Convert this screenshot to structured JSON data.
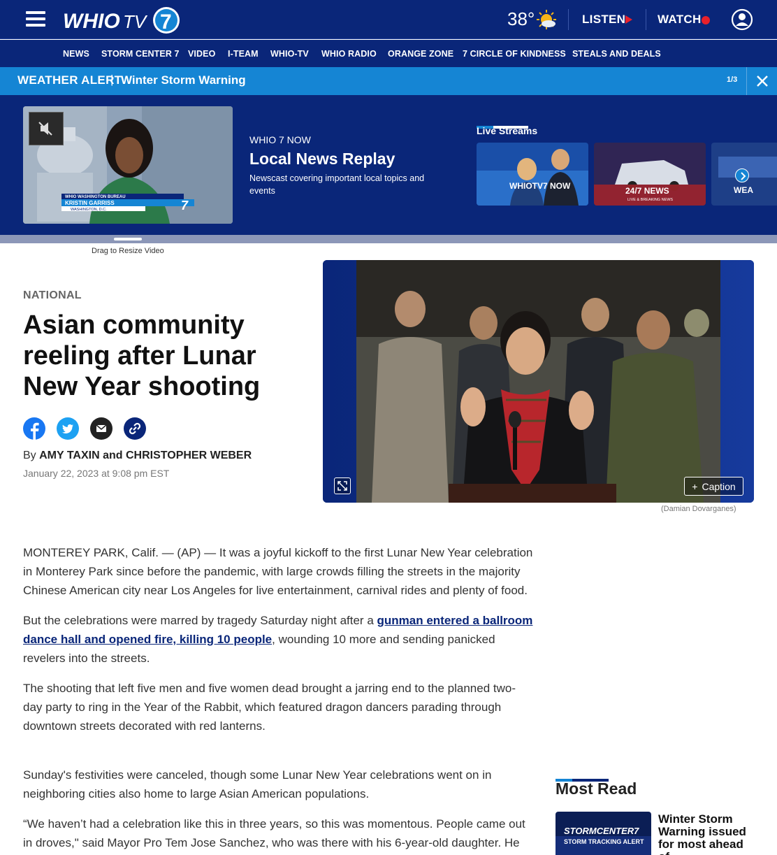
{
  "header": {
    "logo_text": "WHIOTV7",
    "temperature": "38°",
    "weather_icon": "partly-sunny-icon",
    "listen_label": "LISTEN",
    "watch_label": "WATCH"
  },
  "nav": {
    "items": [
      "NEWS",
      "STORM CENTER 7",
      "VIDEO",
      "I-TEAM",
      "WHIO-TV",
      "WHIO RADIO",
      "ORANGE ZONE",
      "7 CIRCLE OF KINDNESS",
      "STEALS AND DEALS"
    ]
  },
  "alert": {
    "label": "WEATHER ALERT",
    "separator": "|",
    "text": "Winter Storm Warning",
    "count": "1/3"
  },
  "video_panel": {
    "thumb_lower_third_bureau": "WHIO WASHINGTON BUREAU",
    "thumb_lower_third_name": "KRISTIN GARRISS",
    "thumb_lower_third_place": "WASHINGTON, D.C.",
    "kicker": "WHIO 7 NOW",
    "title": "Local News Replay",
    "description": "Newscast covering important local topics and events",
    "live_streams_title": "Live Streams",
    "stream_1_label": "WHIOTV7 NOW",
    "stream_2_label": "24/7 NEWS",
    "stream_2_sublabel": "LIVE & BREAKING NEWS",
    "stream_3_label": "WEA",
    "resize_label": "Drag to Resize Video"
  },
  "article": {
    "section": "NATIONAL",
    "headline": "Asian community reeling after Lunar New Year shooting",
    "byline_prefix": "By",
    "authors": "AMY TAXIN and CHRISTOPHER WEBER",
    "date": "January 22, 2023 at 9:08 pm EST",
    "caption_button": "Caption",
    "photo_credit": "(Damian Dovarganes)",
    "p1": "MONTEREY PARK, Calif. — (AP) — It was a joyful kickoff to the first Lunar New Year celebration in Monterey Park since before the pandemic, with large crowds filling the streets in the majority Chinese American city near Los Angeles for live entertainment, carnival rides and plenty of food.",
    "p2_before": "But the celebrations were marred by tragedy Saturday night after a ",
    "p2_link": "gunman entered a ballroom dance hall and opened fire, killing 10 people",
    "p2_after": ", wounding 10 more and sending panicked revelers into the streets.",
    "p3": "The shooting that left five men and five women dead brought a jarring end to the planned two-day party to ring in the Year of the Rabbit, which featured dragon dancers parading through downtown streets decorated with red lanterns.",
    "p4": "Sunday's festivities were canceled, though some Lunar New Year celebrations went on in neighboring cities also home to large Asian American populations.",
    "p5": "“We haven’t had a celebration like this in three years, so this was momentous. People came out in droves,\" said Mayor Pro Tem Jose Sanchez, who was there with his 6-year-old daughter. He"
  },
  "most_read": {
    "title": "Most Read",
    "thumb_text": "STORMCENTER7",
    "thumb_subtext": "STORM TRACKING ALERT",
    "item_1": "Winter Storm Warning issued for most ahead of"
  },
  "colors": {
    "brand_navy": "#0a2679",
    "alert_blue": "#1585d4",
    "live_red": "#e8202a"
  }
}
